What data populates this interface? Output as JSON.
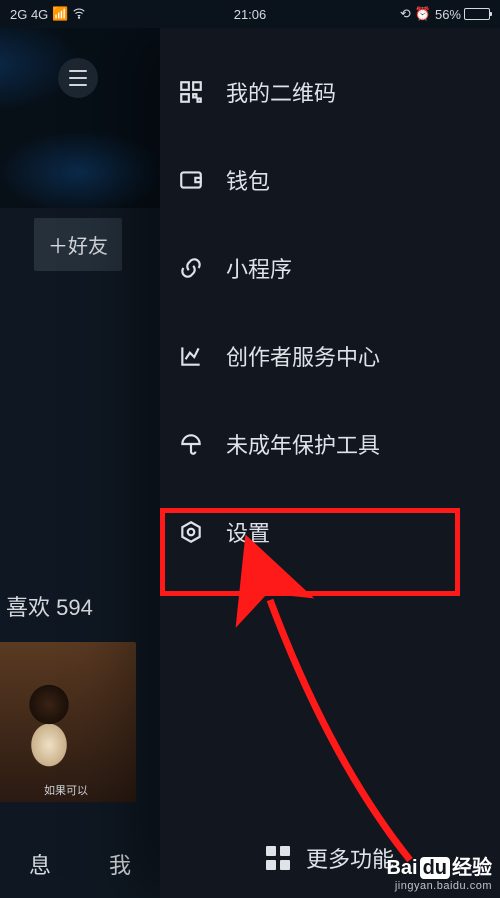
{
  "statusbar": {
    "signal_label": "2G 4G",
    "time": "21:06",
    "battery_percent": "56%",
    "battery_fill_pct": 56
  },
  "main": {
    "add_friend_label": "＋好友",
    "likes_label": "喜欢 594",
    "thumb_caption": "如果可以",
    "tab_messages": "息",
    "tab_me": "我"
  },
  "drawer": {
    "items": [
      {
        "label": "我的二维码",
        "icon": "qrcode-icon"
      },
      {
        "label": "钱包",
        "icon": "wallet-icon"
      },
      {
        "label": "小程序",
        "icon": "link-icon"
      },
      {
        "label": "创作者服务中心",
        "icon": "chart-icon"
      },
      {
        "label": "未成年保护工具",
        "icon": "umbrella-icon"
      },
      {
        "label": "设置",
        "icon": "settings-icon"
      }
    ],
    "more_label": "更多功能"
  },
  "annotation": {
    "highlighted_item_index": 5
  },
  "watermark": {
    "brand": "Baidu 经验",
    "url": "jingyan.baidu.com"
  }
}
